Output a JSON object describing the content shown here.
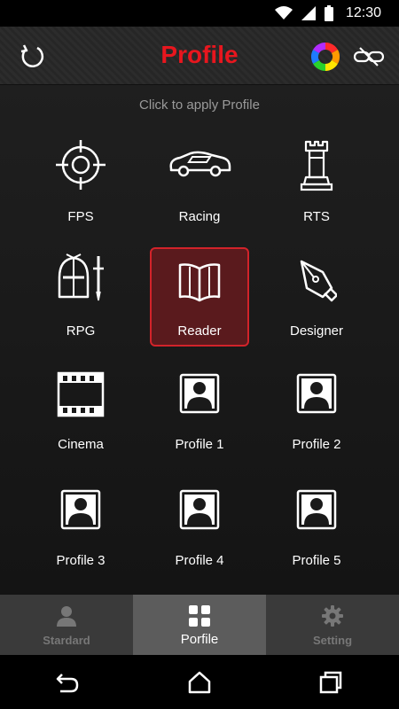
{
  "status": {
    "time": "12:30"
  },
  "header": {
    "title": "Profile"
  },
  "hint": "Click to apply Profile",
  "profiles": [
    {
      "label": "FPS",
      "icon": "crosshair-icon",
      "selected": false
    },
    {
      "label": "Racing",
      "icon": "race-car-icon",
      "selected": false
    },
    {
      "label": "RTS",
      "icon": "chess-rook-icon",
      "selected": false
    },
    {
      "label": "RPG",
      "icon": "knight-helmet-icon",
      "selected": false
    },
    {
      "label": "Reader",
      "icon": "book-icon",
      "selected": true
    },
    {
      "label": "Designer",
      "icon": "pen-nib-icon",
      "selected": false
    },
    {
      "label": "Cinema",
      "icon": "film-icon",
      "selected": false
    },
    {
      "label": "Profile 1",
      "icon": "user-icon",
      "selected": false
    },
    {
      "label": "Profile 2",
      "icon": "user-icon",
      "selected": false
    },
    {
      "label": "Profile 3",
      "icon": "user-icon",
      "selected": false
    },
    {
      "label": "Profile 4",
      "icon": "user-icon",
      "selected": false
    },
    {
      "label": "Profile 5",
      "icon": "user-icon",
      "selected": false
    }
  ],
  "tabs": [
    {
      "label": "Stardard",
      "icon": "person-icon",
      "active": false
    },
    {
      "label": "Porfile",
      "icon": "grid-icon",
      "active": true
    },
    {
      "label": "Setting",
      "icon": "gear-icon",
      "active": false
    }
  ],
  "colors": {
    "accent": "#e8161e",
    "selected_bg": "#5a1a1d",
    "selected_border": "#d2232a"
  }
}
